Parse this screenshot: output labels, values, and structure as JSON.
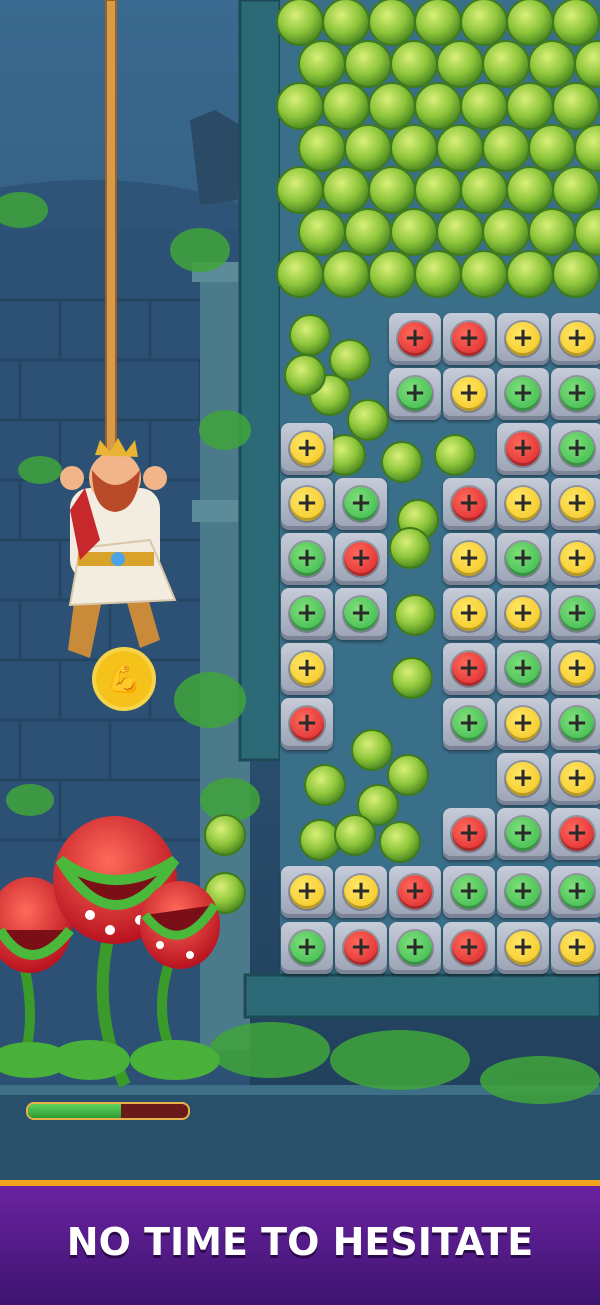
{
  "banner": {
    "text": "NO TIME TO HESITATE"
  },
  "player_health": {
    "fraction": 0.58
  },
  "strength_badge": {
    "icon": "flexed-arm-icon",
    "glyph": "💪"
  },
  "tile_symbol": "+",
  "colors": {
    "yellow": "#f2c21a",
    "green": "#35b44a",
    "red": "#d8212a",
    "banner": "#5a1d8e",
    "banner_border": "#f2a41e"
  },
  "tiles": [
    {
      "c": "red"
    },
    {
      "c": "red"
    },
    {
      "c": "yellow"
    },
    {
      "c": "yellow"
    },
    {
      "c": "green"
    },
    {
      "c": "yellow"
    },
    {
      "c": "green"
    },
    {
      "c": "green"
    },
    {
      "c": "red"
    },
    {
      "c": "green"
    },
    {
      "c": "yellow"
    },
    {
      "c": "yellow"
    },
    {
      "c": "green"
    },
    {
      "c": "red"
    },
    {
      "c": "yellow"
    },
    {
      "c": "yellow"
    },
    {
      "c": "green"
    },
    {
      "c": "red"
    },
    {
      "c": "yellow"
    },
    {
      "c": "green"
    },
    {
      "c": "yellow"
    },
    {
      "c": "green"
    },
    {
      "c": "green"
    },
    {
      "c": "yellow"
    },
    {
      "c": "yellow"
    },
    {
      "c": "green"
    },
    {
      "c": "yellow"
    },
    {
      "c": "red"
    },
    {
      "c": "green"
    },
    {
      "c": "yellow"
    },
    {
      "c": "red"
    },
    {
      "c": "green"
    },
    {
      "c": "yellow"
    },
    {
      "c": "green"
    },
    {
      "c": "yellow"
    },
    {
      "c": "yellow"
    },
    {
      "c": "red"
    },
    {
      "c": "green"
    },
    {
      "c": "red"
    },
    {
      "c": "yellow"
    },
    {
      "c": "yellow"
    },
    {
      "c": "red"
    },
    {
      "c": "green"
    },
    {
      "c": "green"
    },
    {
      "c": "green"
    },
    {
      "c": "green"
    },
    {
      "c": "red"
    },
    {
      "c": "green"
    },
    {
      "c": "red"
    },
    {
      "c": "yellow"
    },
    {
      "c": "yellow"
    }
  ]
}
